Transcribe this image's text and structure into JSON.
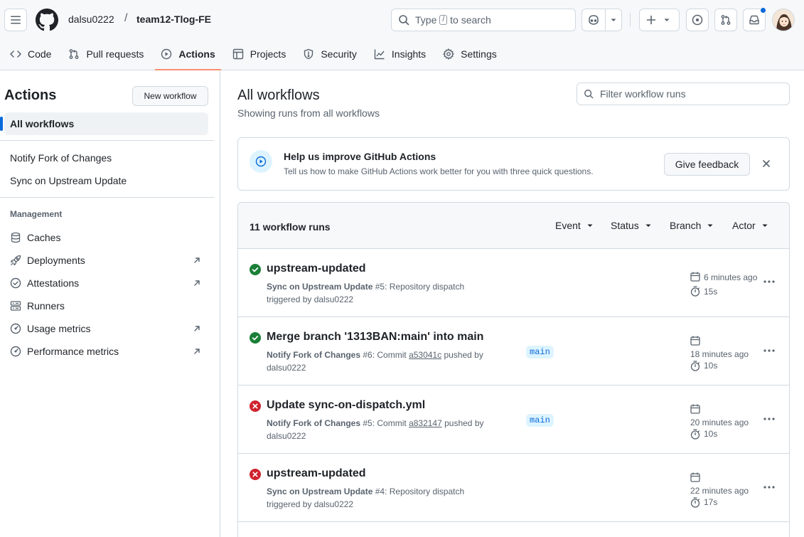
{
  "header": {
    "owner": "dalsu0222",
    "separator": "/",
    "repo": "team12-Tlog-FE",
    "search_prefix": "Type",
    "search_key": "/",
    "search_suffix": "to search"
  },
  "repo_nav": {
    "code": "Code",
    "pull_requests": "Pull requests",
    "actions": "Actions",
    "projects": "Projects",
    "security": "Security",
    "insights": "Insights",
    "settings": "Settings"
  },
  "sidebar": {
    "title": "Actions",
    "new_workflow": "New workflow",
    "all_workflows": "All workflows",
    "workflows": [
      "Notify Fork of Changes",
      "Sync on Upstream Update"
    ],
    "management_heading": "Management",
    "management": [
      "Caches",
      "Deployments",
      "Attestations",
      "Runners",
      "Usage metrics",
      "Performance metrics"
    ]
  },
  "main": {
    "title": "All workflows",
    "subtitle": "Showing runs from all workflows",
    "filter_placeholder": "Filter workflow runs",
    "banner": {
      "title": "Help us improve GitHub Actions",
      "text": "Tell us how to make GitHub Actions work better for you with three quick questions.",
      "button": "Give feedback"
    },
    "runs_count": "11 workflow runs",
    "filters": [
      "Event",
      "Status",
      "Branch",
      "Actor"
    ],
    "runs": [
      {
        "status": "success",
        "title": "upstream-updated",
        "workflow": "Sync on Upstream Update",
        "number": "#5",
        "line1_tail": ": Repository dispatch",
        "line2": "triggered by dalsu0222",
        "branch": "",
        "when": "6 minutes ago",
        "duration": "15s"
      },
      {
        "status": "success",
        "title": "Merge branch '1313BAN:main' into main",
        "workflow": "Notify Fork of Changes",
        "number": "#6",
        "line1_mid": ": Commit ",
        "sha": "a53041c",
        "line1_tail": " pushed by",
        "line2": "dalsu0222",
        "branch": "main",
        "when": "18 minutes ago",
        "duration": "10s"
      },
      {
        "status": "failure",
        "title": "Update sync-on-dispatch.yml",
        "workflow": "Notify Fork of Changes",
        "number": "#5",
        "line1_mid": ": Commit ",
        "sha": "a832147",
        "line1_tail": " pushed by",
        "line2": "dalsu0222",
        "branch": "main",
        "when": "20 minutes ago",
        "duration": "10s"
      },
      {
        "status": "failure",
        "title": "upstream-updated",
        "workflow": "Sync on Upstream Update",
        "number": "#4",
        "line1_tail": ": Repository dispatch",
        "line2": "triggered by dalsu0222",
        "branch": "",
        "when": "22 minutes ago",
        "duration": "17s"
      }
    ]
  },
  "colors": {
    "success": "#1a7f37",
    "failure": "#cf222e",
    "accent": "#0969da",
    "underline": "#fd8c73"
  }
}
